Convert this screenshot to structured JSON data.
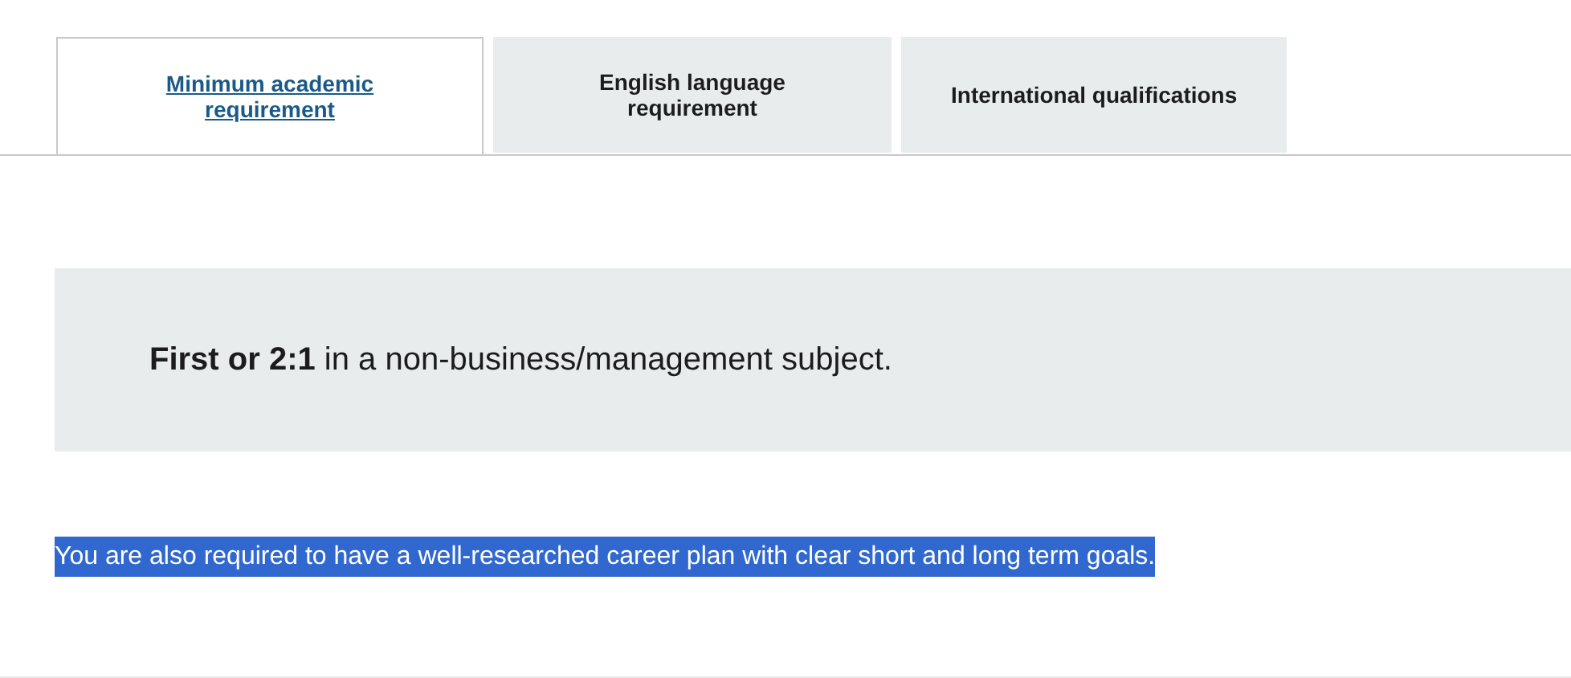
{
  "tabs": [
    {
      "label": "Minimum academic requirement",
      "selected": true
    },
    {
      "label": "English language requirement",
      "selected": false
    },
    {
      "label": "International qualifications",
      "selected": false
    }
  ],
  "requirement": "**First or 2:1** in a non-business/management subject.",
  "note": {
    "text": "You are also required to have a well-researched career plan with clear short and long term goals.",
    "selected": true
  }
}
